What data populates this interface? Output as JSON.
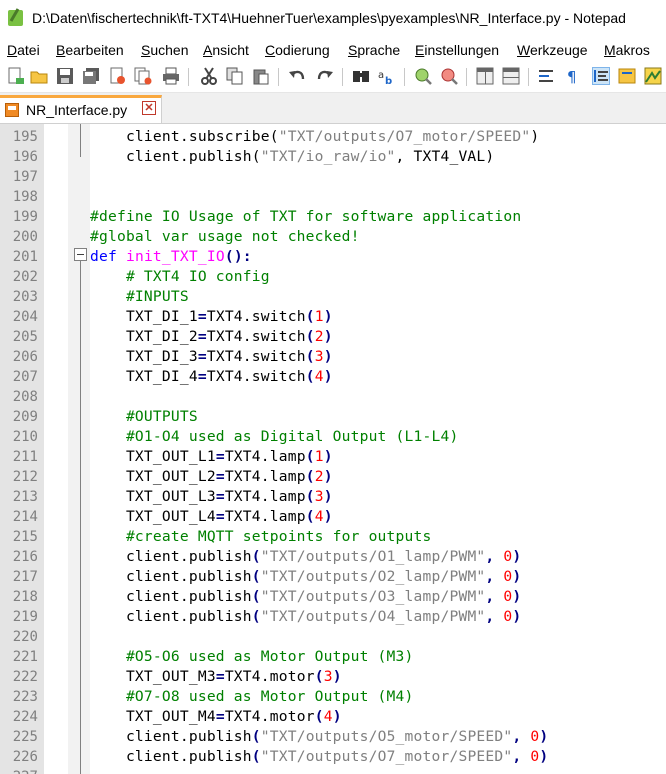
{
  "window": {
    "title": "D:\\Daten\\fischertechnik\\ft-TXT4\\HuehnerTuer\\examples\\pyexamples\\NR_Interface.py - Notepad"
  },
  "menu": [
    "Datei",
    "Bearbeiten",
    "Suchen",
    "Ansicht",
    "Codierung",
    "Sprache",
    "Einstellungen",
    "Werkzeuge",
    "Makros"
  ],
  "toolbar": {
    "icons": [
      "new-file-icon",
      "open-file-icon",
      "save-icon",
      "save-all-icon",
      "close-icon",
      "close-all-icon",
      "print-icon",
      "cut-icon",
      "copy-icon",
      "paste-icon",
      "undo-icon",
      "redo-icon",
      "find-icon",
      "replace-icon",
      "zoom-in-icon",
      "zoom-out-icon",
      "sync-vertical-icon",
      "sync-horizontal-icon",
      "word-wrap-icon",
      "show-all-chars-icon",
      "indent-guide-icon",
      "user-language-icon",
      "document-map-icon"
    ]
  },
  "tab": {
    "label": "NR_Interface.py",
    "close": "✕"
  },
  "editor": {
    "lines": [
      {
        "n": "195",
        "tokens": [
          [
            "",
            "    client.subscribe("
          ],
          [
            "str",
            "\"TXT/outputs/O7_motor/SPEED\""
          ],
          [
            "",
            ")"
          ]
        ]
      },
      {
        "n": "196",
        "tokens": [
          [
            "",
            "    client.publish("
          ],
          [
            "str",
            "\"TXT/io_raw/io\""
          ],
          [
            "",
            ", TXT4_VAL)"
          ]
        ]
      },
      {
        "n": "197",
        "tokens": []
      },
      {
        "n": "198",
        "tokens": []
      },
      {
        "n": "199",
        "tokens": [
          [
            "cm",
            "#define IO Usage of TXT for software application"
          ]
        ]
      },
      {
        "n": "200",
        "tokens": [
          [
            "cm",
            "#global var usage not checked!"
          ]
        ]
      },
      {
        "n": "201",
        "tokens": [
          [
            "kw",
            "def"
          ],
          [
            "",
            " "
          ],
          [
            "fn",
            "init_TXT_IO"
          ],
          [
            "op",
            "():"
          ]
        ]
      },
      {
        "n": "202",
        "tokens": [
          [
            "cm",
            "    # TXT4 IO config"
          ]
        ]
      },
      {
        "n": "203",
        "tokens": [
          [
            "cm",
            "    #INPUTS"
          ]
        ]
      },
      {
        "n": "204",
        "tokens": [
          [
            "",
            "    TXT_DI_1"
          ],
          [
            "op",
            "="
          ],
          [
            "",
            "TXT4.switch"
          ],
          [
            "op",
            "("
          ],
          [
            "num",
            "1"
          ],
          [
            "op",
            ")"
          ]
        ]
      },
      {
        "n": "205",
        "tokens": [
          [
            "",
            "    TXT_DI_2"
          ],
          [
            "op",
            "="
          ],
          [
            "",
            "TXT4.switch"
          ],
          [
            "op",
            "("
          ],
          [
            "num",
            "2"
          ],
          [
            "op",
            ")"
          ]
        ]
      },
      {
        "n": "206",
        "tokens": [
          [
            "",
            "    TXT_DI_3"
          ],
          [
            "op",
            "="
          ],
          [
            "",
            "TXT4.switch"
          ],
          [
            "op",
            "("
          ],
          [
            "num",
            "3"
          ],
          [
            "op",
            ")"
          ]
        ]
      },
      {
        "n": "207",
        "tokens": [
          [
            "",
            "    TXT_DI_4"
          ],
          [
            "op",
            "="
          ],
          [
            "",
            "TXT4.switch"
          ],
          [
            "op",
            "("
          ],
          [
            "num",
            "4"
          ],
          [
            "op",
            ")"
          ]
        ]
      },
      {
        "n": "208",
        "tokens": []
      },
      {
        "n": "209",
        "tokens": [
          [
            "cm",
            "    #OUTPUTS"
          ]
        ]
      },
      {
        "n": "210",
        "tokens": [
          [
            "cm",
            "    #O1-O4 used as Digital Output (L1-L4)"
          ]
        ]
      },
      {
        "n": "211",
        "tokens": [
          [
            "",
            "    TXT_OUT_L1"
          ],
          [
            "op",
            "="
          ],
          [
            "",
            "TXT4.lamp"
          ],
          [
            "op",
            "("
          ],
          [
            "num",
            "1"
          ],
          [
            "op",
            ")"
          ]
        ]
      },
      {
        "n": "212",
        "tokens": [
          [
            "",
            "    TXT_OUT_L2"
          ],
          [
            "op",
            "="
          ],
          [
            "",
            "TXT4.lamp"
          ],
          [
            "op",
            "("
          ],
          [
            "num",
            "2"
          ],
          [
            "op",
            ")"
          ]
        ]
      },
      {
        "n": "213",
        "tokens": [
          [
            "",
            "    TXT_OUT_L3"
          ],
          [
            "op",
            "="
          ],
          [
            "",
            "TXT4.lamp"
          ],
          [
            "op",
            "("
          ],
          [
            "num",
            "3"
          ],
          [
            "op",
            ")"
          ]
        ]
      },
      {
        "n": "214",
        "tokens": [
          [
            "",
            "    TXT_OUT_L4"
          ],
          [
            "op",
            "="
          ],
          [
            "",
            "TXT4.lamp"
          ],
          [
            "op",
            "("
          ],
          [
            "num",
            "4"
          ],
          [
            "op",
            ")"
          ]
        ]
      },
      {
        "n": "215",
        "tokens": [
          [
            "cm",
            "    #create MQTT setpoints for outputs"
          ]
        ]
      },
      {
        "n": "216",
        "tokens": [
          [
            "",
            "    client.publish"
          ],
          [
            "op",
            "("
          ],
          [
            "str",
            "\"TXT/outputs/O1_lamp/PWM\""
          ],
          [
            "op",
            ", "
          ],
          [
            "num",
            "0"
          ],
          [
            "op",
            ")"
          ]
        ]
      },
      {
        "n": "217",
        "tokens": [
          [
            "",
            "    client.publish"
          ],
          [
            "op",
            "("
          ],
          [
            "str",
            "\"TXT/outputs/O2_lamp/PWM\""
          ],
          [
            "op",
            ", "
          ],
          [
            "num",
            "0"
          ],
          [
            "op",
            ")"
          ]
        ]
      },
      {
        "n": "218",
        "tokens": [
          [
            "",
            "    client.publish"
          ],
          [
            "op",
            "("
          ],
          [
            "str",
            "\"TXT/outputs/O3_lamp/PWM\""
          ],
          [
            "op",
            ", "
          ],
          [
            "num",
            "0"
          ],
          [
            "op",
            ")"
          ]
        ]
      },
      {
        "n": "219",
        "tokens": [
          [
            "",
            "    client.publish"
          ],
          [
            "op",
            "("
          ],
          [
            "str",
            "\"TXT/outputs/O4_lamp/PWM\""
          ],
          [
            "op",
            ", "
          ],
          [
            "num",
            "0"
          ],
          [
            "op",
            ")"
          ]
        ]
      },
      {
        "n": "220",
        "tokens": []
      },
      {
        "n": "221",
        "tokens": [
          [
            "cm",
            "    #O5-O6 used as Motor Output (M3)"
          ]
        ]
      },
      {
        "n": "222",
        "tokens": [
          [
            "",
            "    TXT_OUT_M3"
          ],
          [
            "op",
            "="
          ],
          [
            "",
            "TXT4.motor"
          ],
          [
            "op",
            "("
          ],
          [
            "num",
            "3"
          ],
          [
            "op",
            ")"
          ]
        ]
      },
      {
        "n": "223",
        "tokens": [
          [
            "cm",
            "    #O7-O8 used as Motor Output (M4)"
          ]
        ]
      },
      {
        "n": "224",
        "tokens": [
          [
            "",
            "    TXT_OUT_M4"
          ],
          [
            "op",
            "="
          ],
          [
            "",
            "TXT4.motor"
          ],
          [
            "op",
            "("
          ],
          [
            "num",
            "4"
          ],
          [
            "op",
            ")"
          ]
        ]
      },
      {
        "n": "225",
        "tokens": [
          [
            "",
            "    client.publish"
          ],
          [
            "op",
            "("
          ],
          [
            "str",
            "\"TXT/outputs/O5_motor/SPEED\""
          ],
          [
            "op",
            ", "
          ],
          [
            "num",
            "0"
          ],
          [
            "op",
            ")"
          ]
        ]
      },
      {
        "n": "226",
        "tokens": [
          [
            "",
            "    client.publish"
          ],
          [
            "op",
            "("
          ],
          [
            "str",
            "\"TXT/outputs/O7_motor/SPEED\""
          ],
          [
            "op",
            ", "
          ],
          [
            "num",
            "0"
          ],
          [
            "op",
            ")"
          ]
        ]
      },
      {
        "n": "227",
        "tokens": []
      }
    ]
  },
  "colors": {
    "keyword": "#0000ff",
    "function": "#ff00ff",
    "string": "#808080",
    "number": "#ff0000",
    "comment": "#008000",
    "operator": "#000080",
    "tab_accent": "#f9a83f"
  }
}
